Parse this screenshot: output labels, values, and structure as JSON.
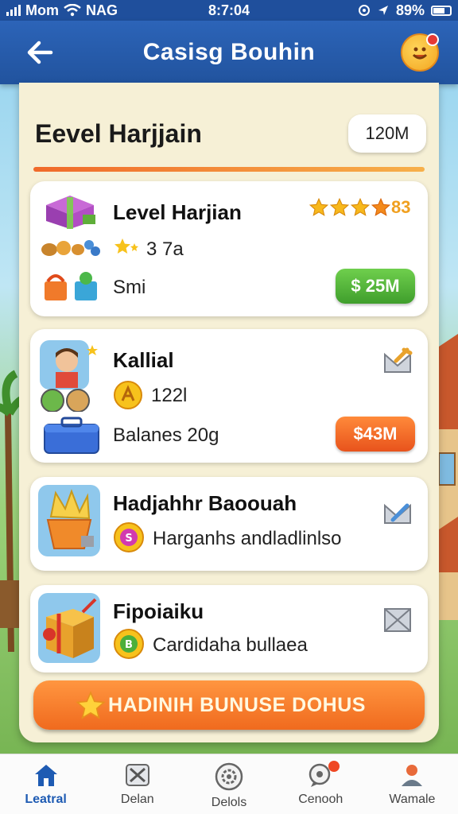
{
  "status_bar": {
    "carrier": "Mom",
    "network": "NAG",
    "time": "8:7:04",
    "battery": "89%"
  },
  "header": {
    "title": "Casisg Bouhin",
    "back_icon": "arrow-left-icon",
    "avatar_icon": "smiley-badge-icon"
  },
  "panel": {
    "title": "Eevel Harjjain",
    "balance": "120M"
  },
  "cards": [
    {
      "title": "Level Harjian",
      "rating_text": "3 7a",
      "stars_label": "83",
      "detail": "Smi",
      "price": "$ 25M",
      "price_color": "#4caf3a"
    },
    {
      "title": "Kallial",
      "sub": "122l",
      "detail": "Balanes 20g",
      "price": "$43M",
      "price_color": "#f0621e"
    },
    {
      "title": "Hadjahhr Baoouah",
      "sub": "Harganhs andladlinlso"
    },
    {
      "title": "Fipoiaiku",
      "sub": "Cardidaha bullaea"
    }
  ],
  "bonus_button": {
    "label": "HADINIH BUNUSE DOHUS",
    "icon": "star-icon"
  },
  "bottom_nav": [
    {
      "label": "Leatral",
      "icon": "home-icon",
      "active": true
    },
    {
      "label": "Delan",
      "icon": "crossed-tools-icon",
      "active": false
    },
    {
      "label": "Delols",
      "icon": "gear-icon",
      "active": false
    },
    {
      "label": "Cenooh",
      "icon": "chat-bubble-icon",
      "active": false
    },
    {
      "label": "Wamale",
      "icon": "person-icon",
      "active": false
    }
  ],
  "colors": {
    "header_blue": "#2a5fb0",
    "panel_cream": "#f6f0d6",
    "accent_orange": "#f06a1e",
    "price_green": "#4caf3a",
    "active_nav": "#1e5bb3"
  }
}
